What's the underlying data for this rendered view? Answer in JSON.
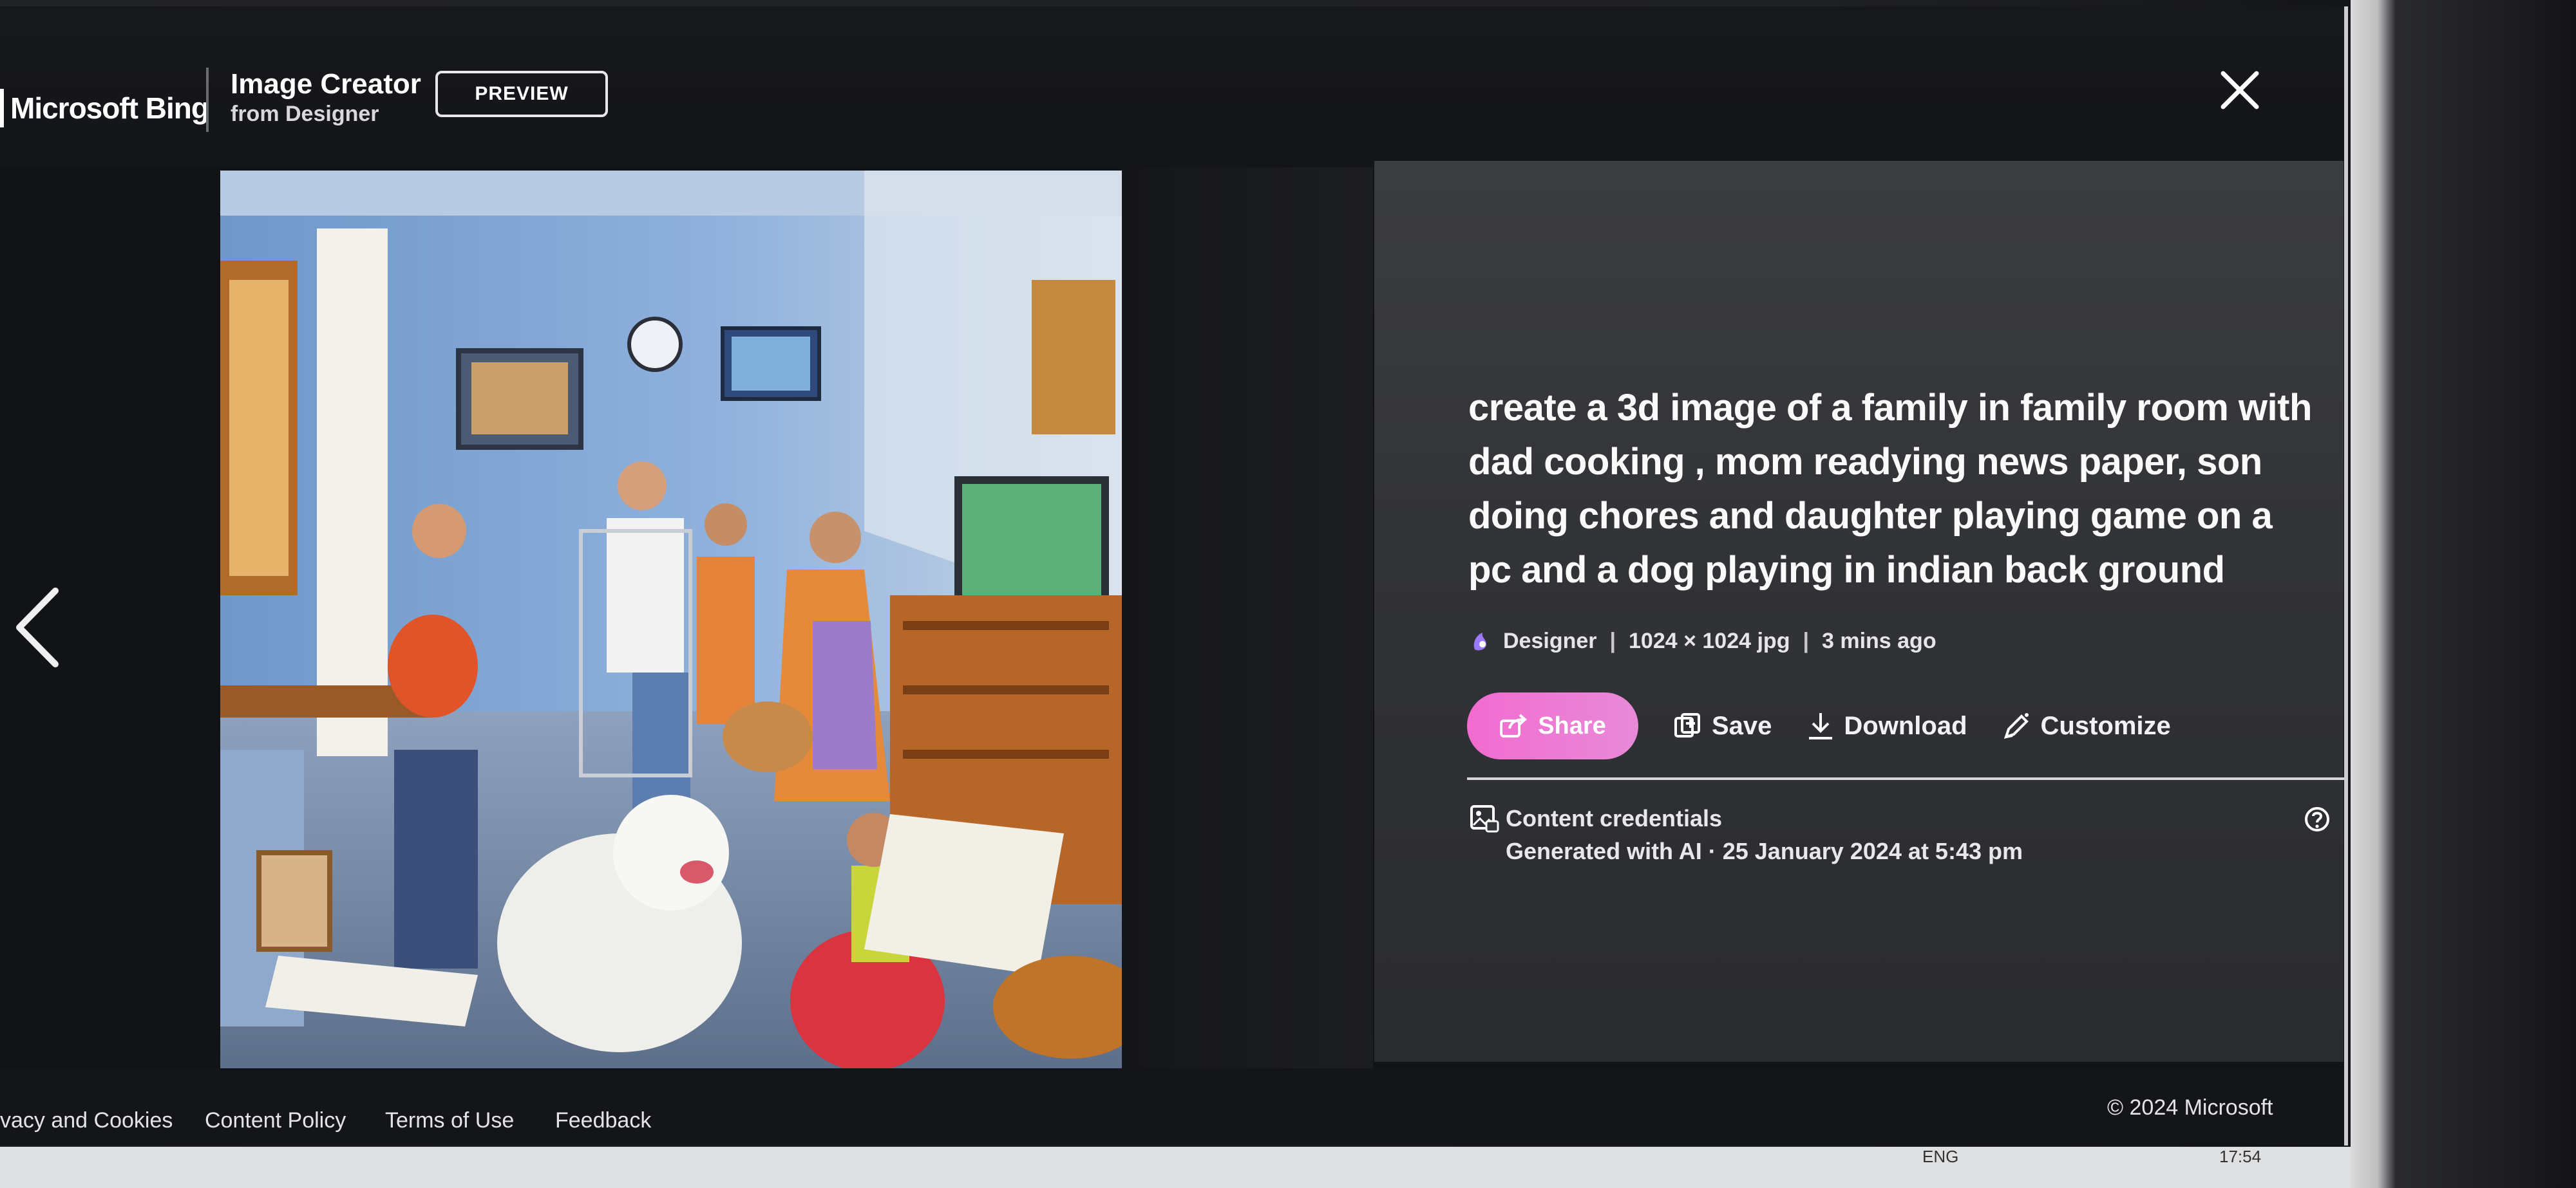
{
  "header": {
    "brand": "Microsoft Bing",
    "product_title": "Image Creator",
    "product_subtitle": "from Designer",
    "badge": "PREVIEW"
  },
  "image": {
    "subject": "3D illustration of an Indian family in a family room"
  },
  "details": {
    "prompt": "create a 3d image of a family in family room with dad cooking , mom readying news paper, son doing chores and daughter playing game on a pc and a dog playing in indian back ground",
    "meta": {
      "source": "Designer",
      "dimensions": "1024 × 1024 jpg",
      "age": "3 mins ago"
    },
    "actions": {
      "share": "Share",
      "save": "Save",
      "download": "Download",
      "customize": "Customize"
    },
    "credentials": {
      "title": "Content credentials",
      "detail": "Generated with AI · 25 January 2024 at 5:43 pm"
    }
  },
  "footer": {
    "links": [
      "vacy and Cookies",
      "Content Policy",
      "Terms of Use",
      "Feedback"
    ],
    "copyright": "© 2024 Microsoft"
  },
  "taskbar": {
    "lang": "ENG",
    "time": "17:54"
  },
  "colors": {
    "share_pink": "#f26bd0",
    "panel_bg": "#35363a",
    "page_bg": "#121316"
  },
  "icons": [
    "close-icon",
    "chevron-left-icon",
    "designer-icon",
    "share-icon",
    "save-icon",
    "download-icon",
    "customize-icon",
    "content-credentials-icon",
    "help-icon"
  ]
}
